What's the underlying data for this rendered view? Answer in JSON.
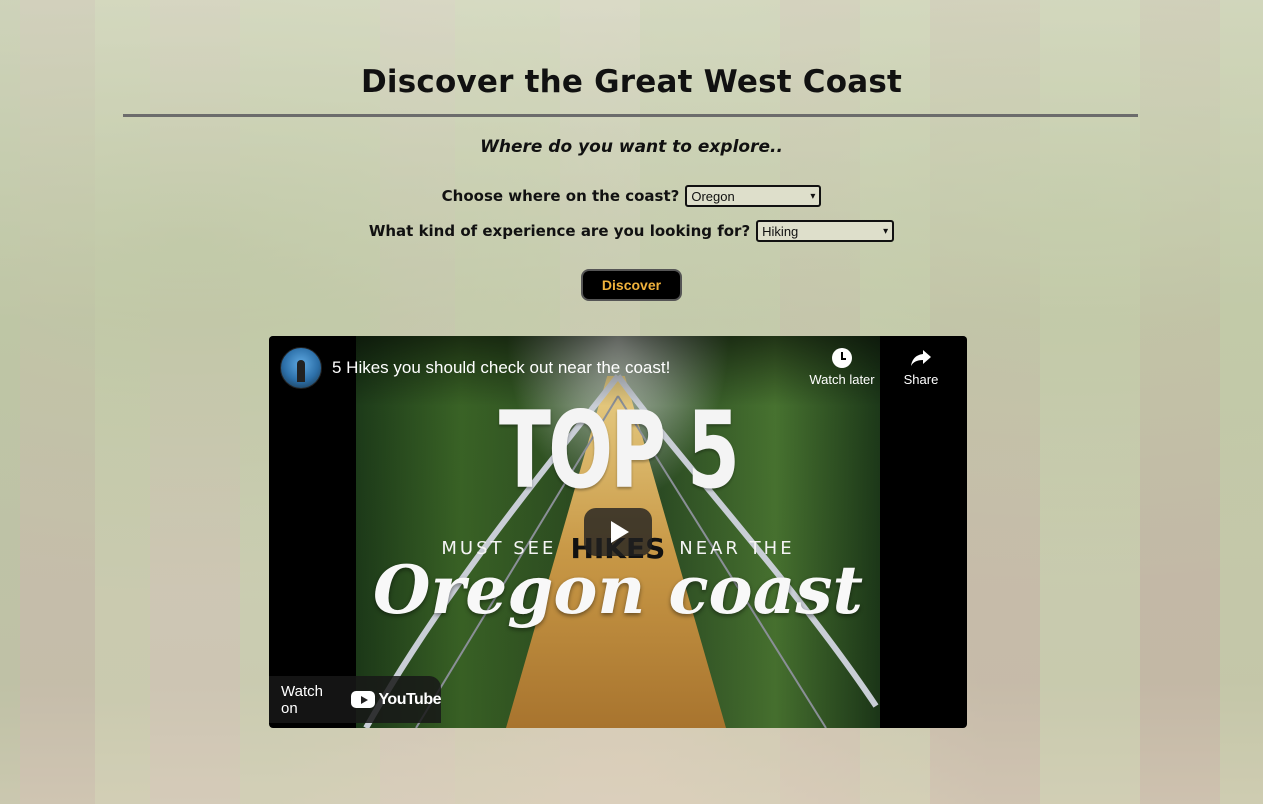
{
  "page": {
    "title": "Discover the Great West Coast",
    "subtitle": "Where do you want to explore.."
  },
  "form": {
    "region_label": "Choose where on the coast?",
    "region_value": "Oregon",
    "experience_label": "What kind of experience are you looking for?",
    "experience_value": "Hiking",
    "submit_label": "Discover"
  },
  "video": {
    "title": "5 Hikes you should check out near the coast!",
    "watch_later_label": "Watch later",
    "share_label": "Share",
    "watch_on_label": "Watch on",
    "platform_label": "YouTube",
    "thumbnail": {
      "headline": "TOP 5",
      "line_left": "MUST SEE",
      "line_highlight": "HIKES",
      "line_right": "NEAR THE",
      "script": "Oregon coast"
    }
  },
  "colors": {
    "button_bg": "#000000",
    "button_text": "#f0b23c",
    "rule": "#6c6c6c",
    "select_bg": "#dedfcb"
  }
}
